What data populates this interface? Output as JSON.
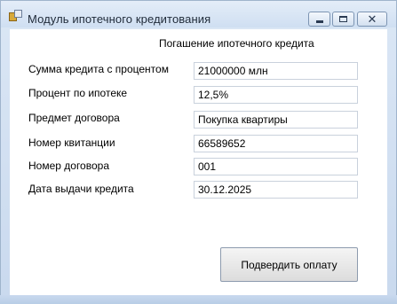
{
  "window": {
    "title": "Модуль ипотечного кредитования"
  },
  "form": {
    "header": "Погашение ипотечного кредита",
    "fields": [
      {
        "label": "Сумма кредита с процентом",
        "value": "21000000 млн"
      },
      {
        "label": "Процент по ипотеке",
        "value": "12,5%"
      },
      {
        "label": "Предмет договора",
        "value": "Покупка квартиры"
      },
      {
        "label": "Номер квитанции",
        "value": "66589652"
      },
      {
        "label": "Номер договора",
        "value": "001"
      },
      {
        "label": "Дата выдачи кредита",
        "value": "30.12.2025"
      }
    ],
    "confirm_button": "Подвердить оплату"
  },
  "icons": {
    "app": "app-icon",
    "minimize": "minimize-icon",
    "maximize": "maximize-icon",
    "close": "close-icon"
  }
}
